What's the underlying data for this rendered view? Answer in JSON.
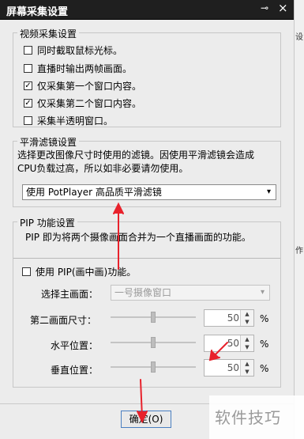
{
  "window": {
    "title": "屏幕采集设置",
    "pin_icon": "pin-icon",
    "close_icon": "close-icon"
  },
  "video_capture": {
    "title": "视频采集设置",
    "options": [
      {
        "label": "同时截取鼠标光标。",
        "checked": false
      },
      {
        "label": "直播时输出两帧画面。",
        "checked": false
      },
      {
        "label": "仅采集第一个窗口内容。",
        "checked": true
      },
      {
        "label": "仅采集第二个窗口内容。",
        "checked": true
      },
      {
        "label": "采集半透明窗口。",
        "checked": false
      }
    ]
  },
  "smooth_filter": {
    "title": "平滑滤镜设置",
    "description_line1": "选择更改图像尺寸时使用的滤镜。因使用平滑滤镜会造成",
    "description_line2": "CPU负载过高，所以如非必要请勿使用。",
    "selected": "使用 PotPlayer 高品质平滑滤镜"
  },
  "pip": {
    "title": "PIP 功能设置",
    "description": "PIP 即为将两个摄像画面合并为一个直播画面的功能。",
    "use_label": "使用 PIP(画中画)功能。",
    "use_checked": false,
    "main_label": "选择主画面：",
    "main_value": "一号摄像窗口",
    "size_label": "第二画面尺寸：",
    "size_value": "50",
    "size_level": 0.5,
    "hpos_label": "水平位置：",
    "hpos_value": "50",
    "hpos_level": 0.5,
    "vpos_label": "垂直位置：",
    "vpos_value": "50",
    "vpos_level": 0.5,
    "unit": "%"
  },
  "ok_button": "确定(O)",
  "watermark": "软件技巧",
  "right_strip": {
    "a": "设",
    "b": "作"
  },
  "colors": {
    "arrow": "#e8222c",
    "title_bar": "#1f1f1f",
    "button_border": "#4a7fc1"
  }
}
